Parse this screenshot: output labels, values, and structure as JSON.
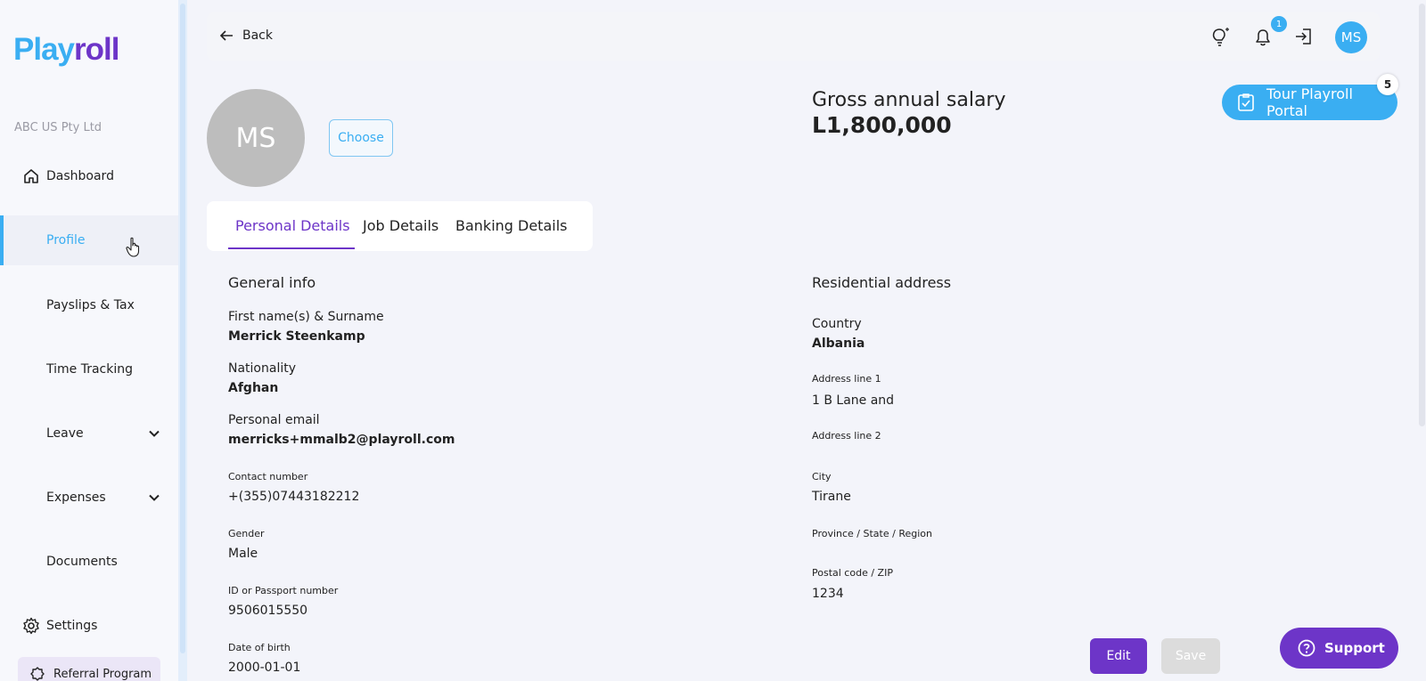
{
  "brand": {
    "logo_part1": "Play",
    "logo_part2": "roll",
    "color_primary": "#3aaef2",
    "color_accent": "#6d35c8"
  },
  "sidebar": {
    "company": "ABC US Pty Ltd",
    "items": [
      {
        "label": "Dashboard",
        "icon": "home-icon"
      },
      {
        "label": "Profile",
        "active": true
      },
      {
        "label": "Payslips & Tax"
      },
      {
        "label": "Time Tracking"
      },
      {
        "label": "Leave",
        "expandable": true
      },
      {
        "label": "Expenses",
        "expandable": true
      },
      {
        "label": "Documents"
      },
      {
        "label": "Settings",
        "icon": "gear-icon"
      }
    ],
    "referral": "Referral Program"
  },
  "topbar": {
    "back_label": "Back",
    "notification_count": "1",
    "user_initials": "MS"
  },
  "profile": {
    "initials": "MS",
    "choose_label": "Choose",
    "salary_label": "Gross annual salary",
    "salary_value": "L1,800,000",
    "tour_label": "Tour Playroll Portal",
    "tour_badge": "5"
  },
  "tabs": [
    "Personal Details",
    "Job Details",
    "Banking Details"
  ],
  "general": {
    "title": "General info",
    "name_label": "First name(s) & Surname",
    "name_value": "Merrick Steenkamp",
    "nationality_label": "Nationality",
    "nationality_value": "Afghan",
    "email_label": "Personal email",
    "email_value": "merricks+mmalb2@playroll.com",
    "contact_label": "Contact number",
    "contact_value": "+(355)07443182212",
    "gender_label": "Gender",
    "gender_value": "Male",
    "id_label": "ID or Passport number",
    "id_value": "9506015550",
    "dob_label": "Date of birth",
    "dob_value": "2000-01-01"
  },
  "address": {
    "title": "Residential address",
    "country_label": "Country",
    "country_value": "Albania",
    "line1_label": "Address line 1",
    "line1_value": "1 B Lane and",
    "line2_label": "Address line 2",
    "city_label": "City",
    "city_value": "Tirane",
    "province_label": "Province / State / Region",
    "postal_label": "Postal code / ZIP",
    "postal_value": "1234"
  },
  "actions": {
    "edit": "Edit",
    "save": "Save",
    "support": "Support"
  }
}
